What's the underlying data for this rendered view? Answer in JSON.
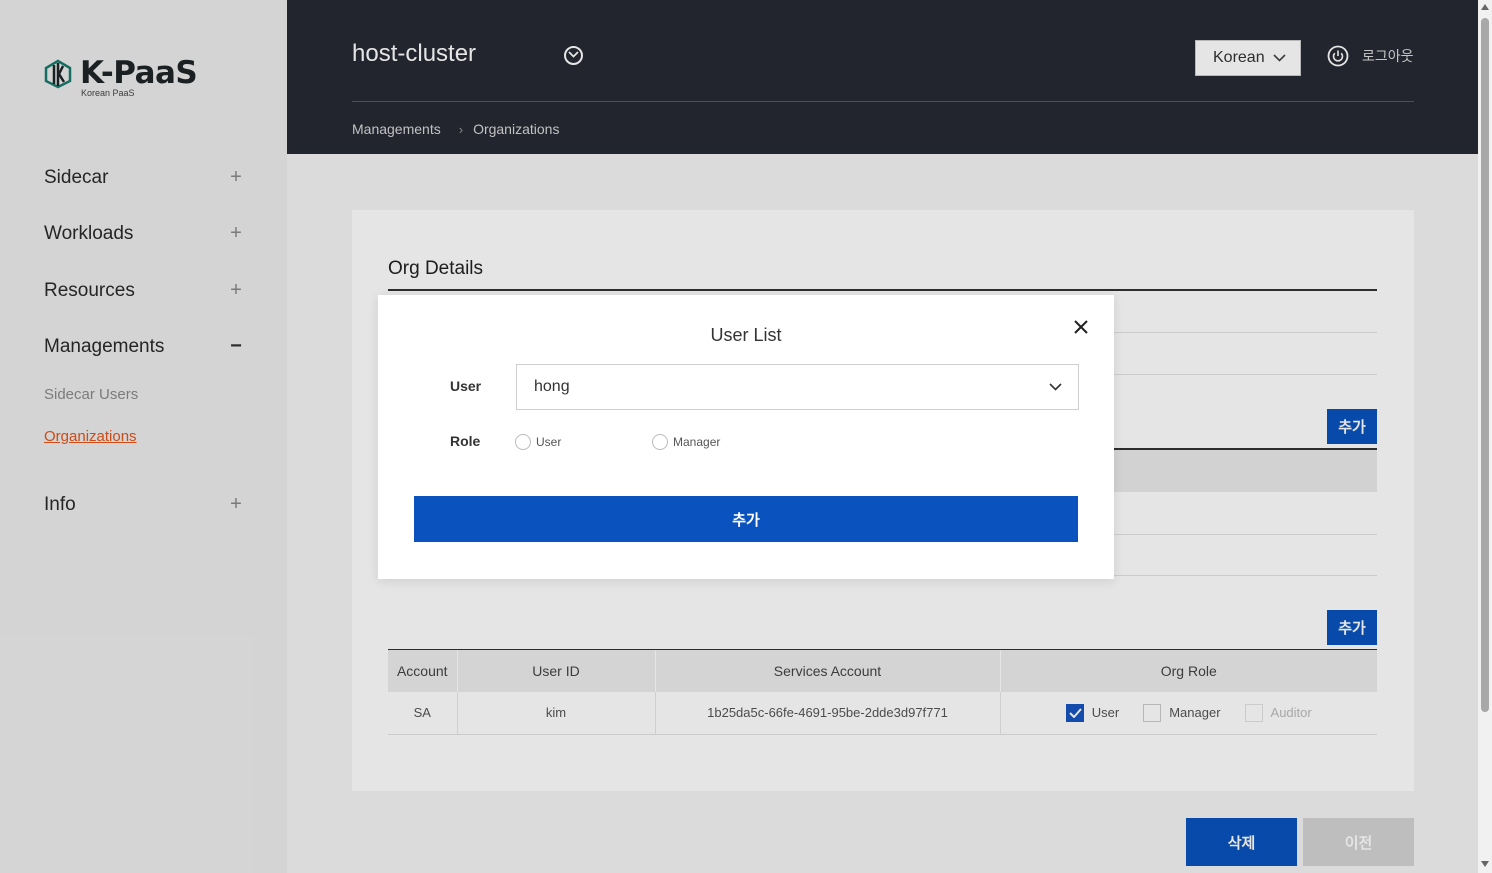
{
  "logo": {
    "main": "K-PaaS",
    "sub": "Korean PaaS"
  },
  "sidebar": {
    "items": [
      {
        "label": "Sidecar",
        "toggle": "+"
      },
      {
        "label": "Workloads",
        "toggle": "+"
      },
      {
        "label": "Resources",
        "toggle": "+"
      },
      {
        "label": "Managements",
        "toggle": "−"
      },
      {
        "label": "Info",
        "toggle": "+"
      }
    ],
    "subitems": [
      {
        "label": "Sidecar Users"
      },
      {
        "label": "Organizations"
      }
    ]
  },
  "header": {
    "cluster": "host-cluster",
    "language": "Korean",
    "logout": "로그아웃",
    "breadcrumb": [
      "Managements",
      "Organizations"
    ],
    "breadcrumb_sep": "›"
  },
  "panel": {
    "title": "Org Details",
    "add_label": "추가",
    "columns": [
      "Account",
      "User ID",
      "Services Account",
      "Org Role"
    ],
    "rows": [
      {
        "account": "SA",
        "user_id": "kim",
        "services_account": "1b25da5c-66fe-4691-95be-2dde3d97f771",
        "roles": [
          {
            "label": "User",
            "checked": true,
            "disabled": false
          },
          {
            "label": "Manager",
            "checked": false,
            "disabled": false
          },
          {
            "label": "Auditor",
            "checked": false,
            "disabled": true
          }
        ]
      }
    ]
  },
  "footer": {
    "delete_label": "삭제",
    "prev_label": "이전"
  },
  "modal": {
    "title": "User List",
    "user_label": "User",
    "user_value": "hong",
    "role_label": "Role",
    "role_options": [
      "User",
      "Manager"
    ],
    "add_label": "추가"
  },
  "colors": {
    "accent": "#0a53be",
    "header_bg": "#262a33",
    "active_nav": "#e2551a"
  }
}
